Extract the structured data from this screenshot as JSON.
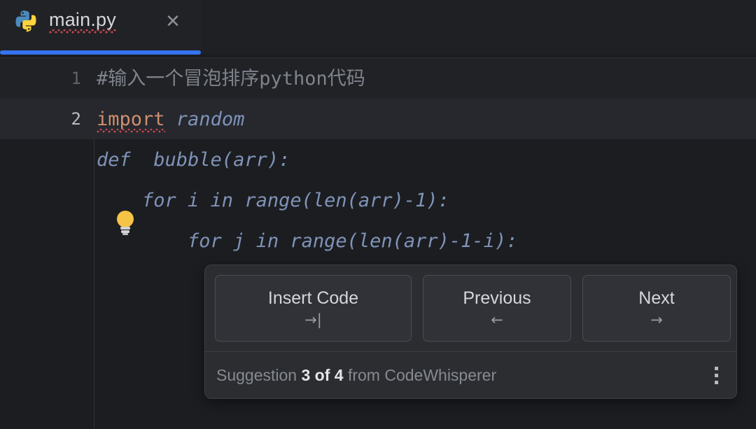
{
  "window": {
    "background_color": "#1c1d21"
  },
  "tab_bar": {
    "active_tab": {
      "icon": "python-file-icon",
      "title": "main.py",
      "has_error_squiggle": true,
      "close_icon": "close-icon",
      "close_glyph": "✕",
      "active_indicator_color": "#3574f0"
    }
  },
  "editor": {
    "gutter": {
      "line_numbers": [
        "1",
        "2"
      ],
      "current_line": "2"
    },
    "lines": [
      {
        "number": "1",
        "kind": "comment",
        "text": "#输入一个冒泡排序python代码"
      },
      {
        "number": "2",
        "kind": "code",
        "keyword": "import",
        "ghost": " random"
      },
      {
        "number": "",
        "kind": "ghost",
        "text": "def  bubble(arr):"
      },
      {
        "number": "",
        "kind": "ghost",
        "text": "    for i in range(len(arr)-1):"
      },
      {
        "number": "",
        "kind": "ghost",
        "text": "        for j in range(len(arr)-1-i):"
      }
    ],
    "intention_bulb": {
      "icon": "lightbulb-icon",
      "color": "#f5c345"
    },
    "colors": {
      "comment": "#7e838c",
      "keyword": "#cf8e6d",
      "ghost_text": "#7f93b8",
      "error_squiggle": "#c94a52"
    }
  },
  "suggestion_popup": {
    "buttons": [
      {
        "name": "insert-code",
        "label": "Insert Code",
        "key_hint": "→|"
      },
      {
        "name": "previous",
        "label": "Previous",
        "key_hint": "←"
      },
      {
        "name": "next",
        "label": "Next",
        "key_hint": "→"
      }
    ],
    "footer": {
      "prefix": "Suggestion ",
      "count": "3 of 4",
      "suffix": " from CodeWhisperer",
      "menu_icon": "more-vertical-icon"
    }
  }
}
